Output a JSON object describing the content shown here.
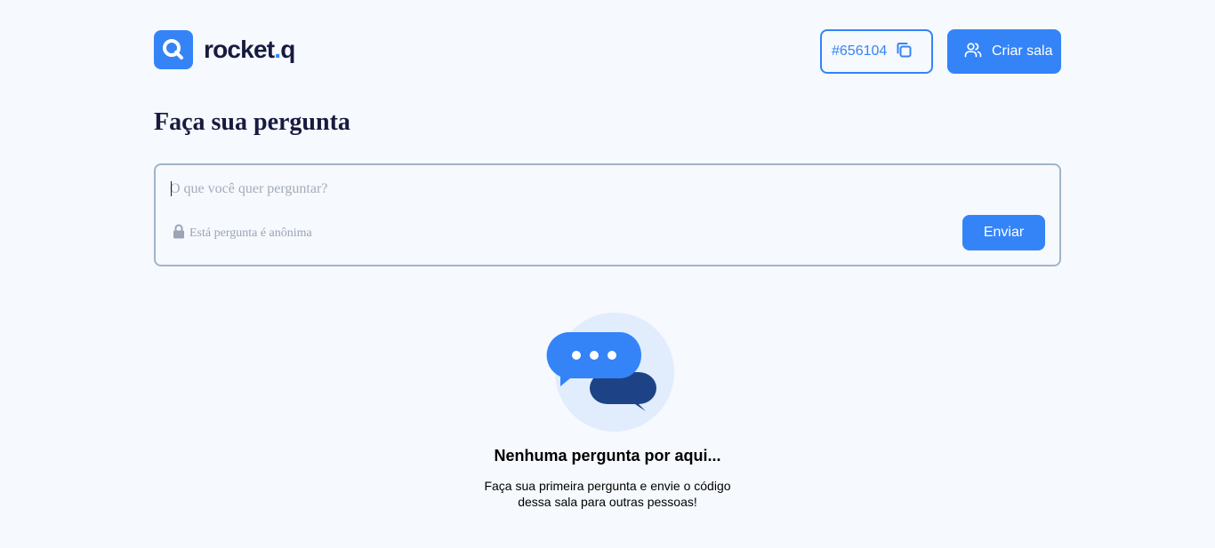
{
  "header": {
    "logo_text": "rocket",
    "logo_dot": ".",
    "logo_suffix": "q",
    "room_code": "#656104",
    "create_room_label": "Criar sala"
  },
  "main": {
    "title": "Faça sua pergunta",
    "question_placeholder": "O que você quer perguntar?",
    "anonymous_note": "Está pergunta é anônima",
    "send_label": "Enviar"
  },
  "empty_state": {
    "title": "Nenhuma pergunta por aqui...",
    "description": "Faça sua primeira pergunta e envie o código dessa sala para outras pessoas!"
  },
  "icons": {
    "logo": "search-icon",
    "copy": "copy-icon",
    "users": "users-icon",
    "lock": "lock-icon",
    "chat": "chat-bubbles-icon"
  },
  "colors": {
    "accent": "#3484f8",
    "dark_text": "#181b3f",
    "background": "#f6f9fd",
    "border": "#a3b4c8",
    "bubble_dark": "#1d4386"
  }
}
